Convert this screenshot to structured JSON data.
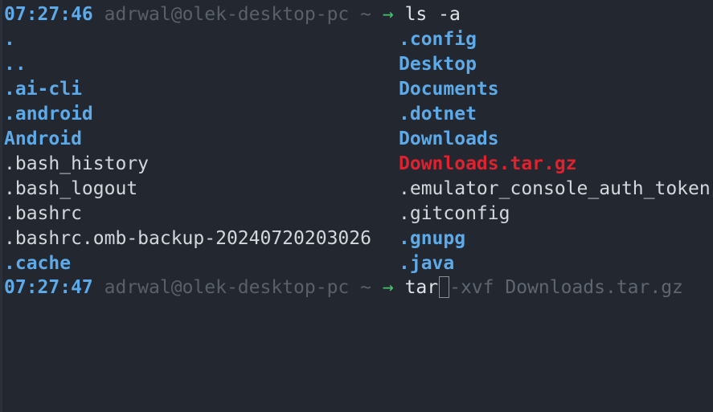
{
  "prompt1": {
    "time": "07:27:46",
    "host": "adrwal@olek-desktop-pc ~",
    "arrow": "→",
    "command": "ls -a"
  },
  "listing": {
    "col1": [
      {
        "name": ".",
        "kind": "dir"
      },
      {
        "name": "..",
        "kind": "dir"
      },
      {
        "name": ".ai-cli",
        "kind": "dir"
      },
      {
        "name": ".android",
        "kind": "dir"
      },
      {
        "name": "Android",
        "kind": "dir"
      },
      {
        "name": ".bash_history",
        "kind": "file"
      },
      {
        "name": ".bash_logout",
        "kind": "file"
      },
      {
        "name": ".bashrc",
        "kind": "file"
      },
      {
        "name": ".bashrc.omb-backup-20240720203026",
        "kind": "file"
      },
      {
        "name": ".cache",
        "kind": "dir"
      }
    ],
    "col2": [
      {
        "name": ".config",
        "kind": "dir"
      },
      {
        "name": "Desktop",
        "kind": "dir"
      },
      {
        "name": "Documents",
        "kind": "dir"
      },
      {
        "name": ".dotnet",
        "kind": "dir"
      },
      {
        "name": "Downloads",
        "kind": "dir"
      },
      {
        "name": "Downloads.tar.gz",
        "kind": "archive"
      },
      {
        "name": ".emulator_console_auth_token",
        "kind": "file"
      },
      {
        "name": ".gitconfig",
        "kind": "file"
      },
      {
        "name": ".gnupg",
        "kind": "dir"
      },
      {
        "name": ".java",
        "kind": "dir"
      }
    ]
  },
  "prompt2": {
    "time": "07:27:47",
    "host": "adrwal@olek-desktop-pc ~",
    "arrow": "→",
    "command": "tar",
    "autosuggestion": "-xvf Downloads.tar.gz"
  },
  "colors": {
    "background": "#222730",
    "directory": "#5eaae8",
    "archive": "#e0212e",
    "prompt_arrow": "#45c46c",
    "dim": "#5a6068"
  }
}
